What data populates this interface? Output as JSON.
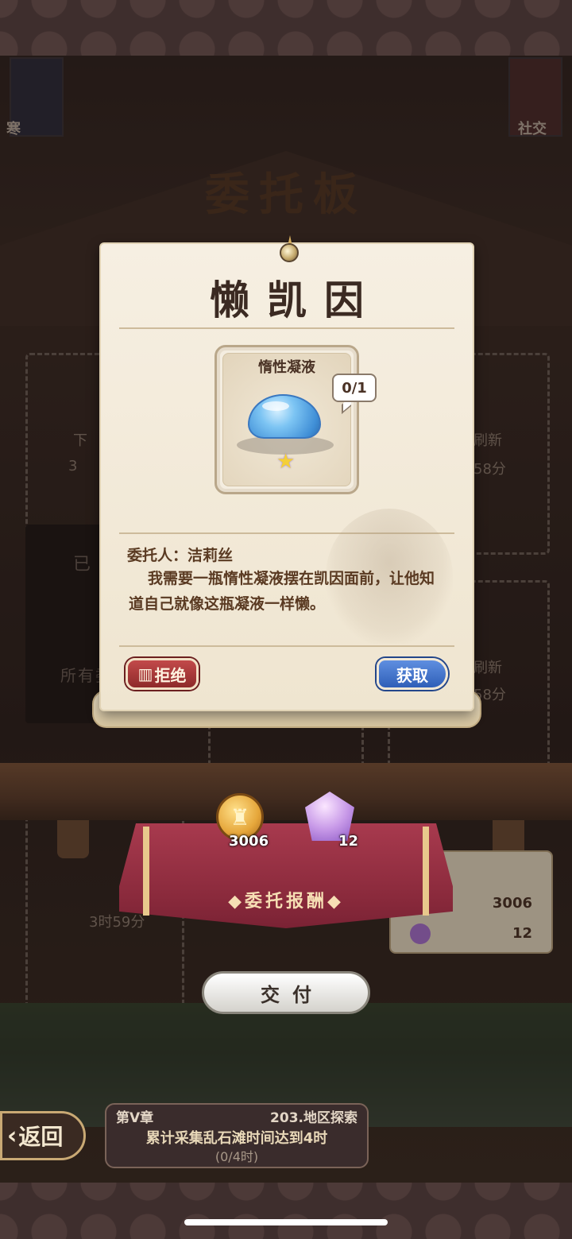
{
  "side_panels": {
    "left_label": "寒",
    "right_label": "社交"
  },
  "board": {
    "title": "委托板"
  },
  "slots": {
    "left_top_text": "下",
    "left_timer": "3",
    "right_top_text": "刷新",
    "right_timer": "58分",
    "right_mid_text": "刷新",
    "right_mid_timer": "58分",
    "left_bottom_timer": "3时59分"
  },
  "dark_panel": {
    "top_text": "已",
    "bottom_text": "所有委托"
  },
  "card": {
    "title": "懒凯因",
    "item": {
      "name": "惰性凝液",
      "icon": "slime-icon",
      "count": "0/1",
      "rarity_icon": "star-icon"
    },
    "client_label": "委托人：洁莉丝",
    "description": "我需要一瓶惰性凝液摆在凯因面前，让他知道自己就像这瓶凝液一样懒。",
    "reject_label": "拒绝",
    "acquire_label": "获取"
  },
  "rewards": {
    "label": "◆委托报酬◆",
    "items": [
      {
        "icon": "gold-coin-icon",
        "count": "3006"
      },
      {
        "icon": "purple-gem-icon",
        "count": "12"
      }
    ]
  },
  "mini_card": {
    "coin_value": "3006",
    "gem_value": "12"
  },
  "deliver_label": "交付",
  "nav": {
    "back_label": "返回"
  },
  "quest": {
    "chapter": "第V章",
    "region": "203.地区探索",
    "description": "累计采集乱石滩时间达到4时",
    "progress": "(0/4时)"
  },
  "colors": {
    "card_bg": "#f6efe2",
    "reject": "#a83434",
    "acquire": "#3e6ec8",
    "reward_cloth": "#8a2a3c"
  }
}
